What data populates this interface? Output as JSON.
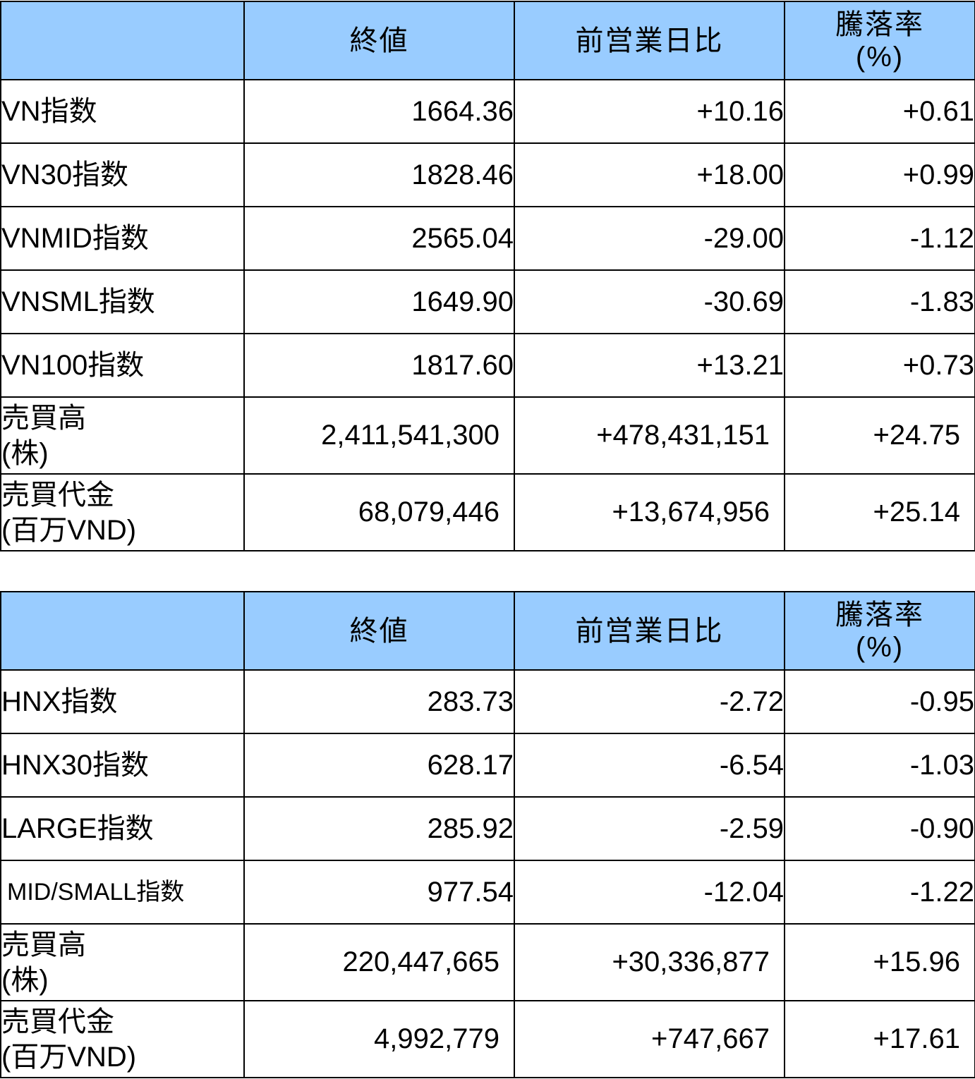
{
  "headers": {
    "close": "終値",
    "change": "前営業日比",
    "rate_line1": "騰落率",
    "rate_line2": "(%)"
  },
  "hose": {
    "rows": [
      {
        "label": "VN指数",
        "close": "1664.36",
        "change": "+10.16",
        "rate": "+0.61"
      },
      {
        "label": "VN30指数",
        "close": "1828.46",
        "change": "+18.00",
        "rate": "+0.99"
      },
      {
        "label": "VNMID指数",
        "close": "2565.04",
        "change": "-29.00",
        "rate": "-1.12"
      },
      {
        "label": "VNSML指数",
        "close": "1649.90",
        "change": "-30.69",
        "rate": "-1.83"
      },
      {
        "label": "VN100指数",
        "close": "1817.60",
        "change": "+13.21",
        "rate": "+0.73"
      }
    ],
    "volume": {
      "label1": "売買高",
      "label2": "(株)",
      "close": "2,411,541,300",
      "change": "+478,431,151",
      "rate": "+24.75"
    },
    "value": {
      "label1": "売買代金",
      "label2": "(百万VND)",
      "close": "68,079,446",
      "change": "+13,674,956",
      "rate": "+25.14"
    }
  },
  "hnx": {
    "rows": [
      {
        "label": "HNX指数",
        "close": "283.73",
        "change": "-2.72",
        "rate": "-0.95"
      },
      {
        "label": "HNX30指数",
        "close": "628.17",
        "change": "-6.54",
        "rate": "-1.03"
      },
      {
        "label": "LARGE指数",
        "close": "285.92",
        "change": "-2.59",
        "rate": "-0.90"
      },
      {
        "label": "MID/SMALL指数",
        "close": "977.54",
        "change": "-12.04",
        "rate": "-1.22"
      }
    ],
    "volume": {
      "label1": "売買高",
      "label2": "(株)",
      "close": "220,447,665",
      "change": "+30,336,877",
      "rate": "+15.96"
    },
    "value": {
      "label1": "売買代金",
      "label2": "(百万VND)",
      "close": "4,992,779",
      "change": "+747,667",
      "rate": "+17.61"
    }
  }
}
